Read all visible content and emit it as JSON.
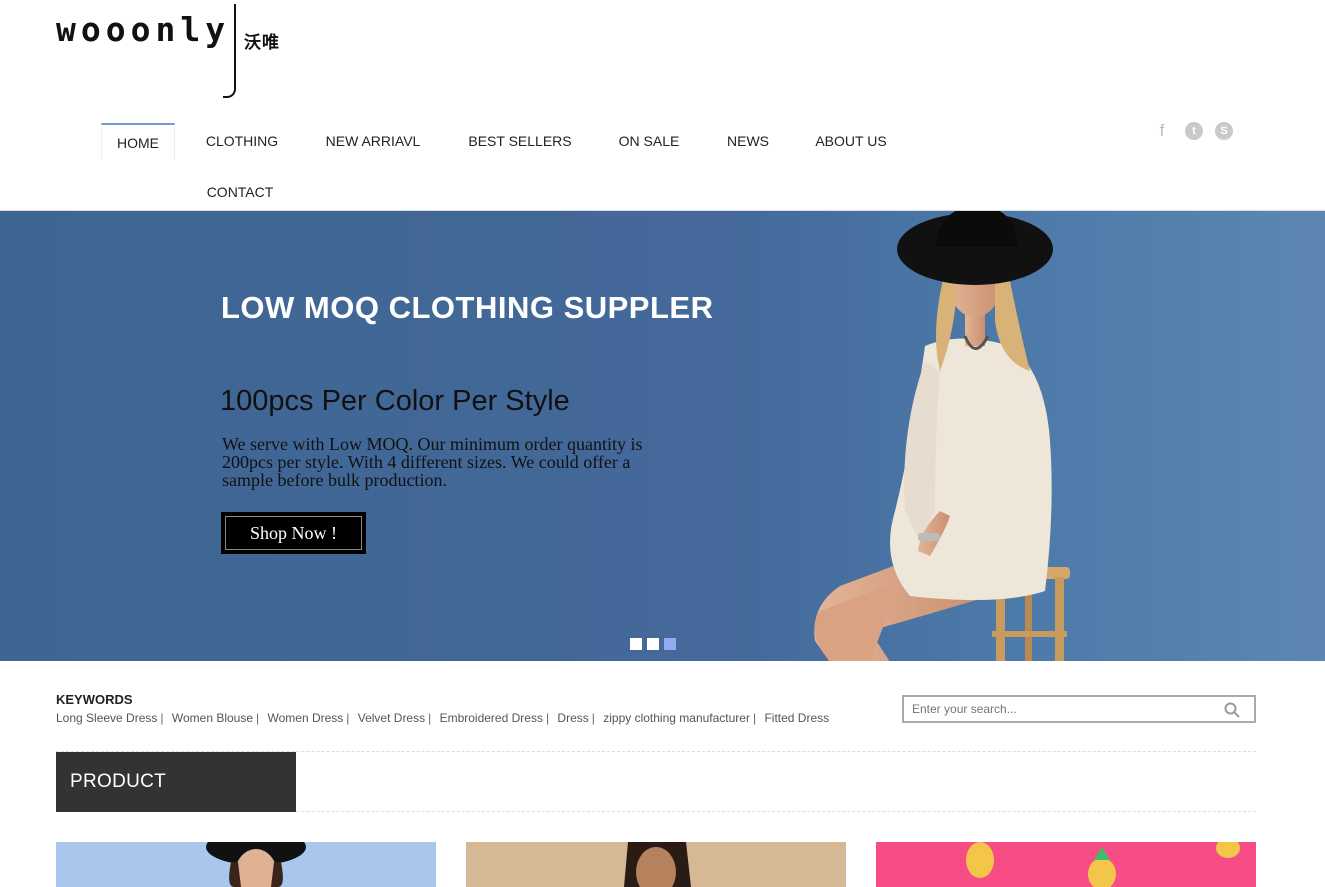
{
  "logo": {
    "wordmark": "wooonly",
    "chinese": "沃唯"
  },
  "nav": {
    "items": [
      {
        "label": "HOME",
        "active": true
      },
      {
        "label": "CLOTHING"
      },
      {
        "label": "NEW ARRIAVL"
      },
      {
        "label": "BEST SELLERS"
      },
      {
        "label": "ON SALE"
      },
      {
        "label": "NEWS"
      },
      {
        "label": "ABOUT US"
      },
      {
        "label": "CONTACT"
      }
    ]
  },
  "social": {
    "facebook": "f",
    "twitter": "t",
    "skype": "S"
  },
  "banner": {
    "headline": "LOW MOQ CLOTHING SUPPLER",
    "subheadline": "100pcs Per Color Per Style",
    "description": "We serve with Low MOQ. Our minimum order quantity is 200pcs per style. With 4 different sizes. We could offer a sample before bulk production.",
    "cta": "Shop Now !",
    "slides": 3,
    "active_slide": 3,
    "bg_color": "#44699a"
  },
  "keywords": {
    "title": "KEYWORDS",
    "items": [
      "Long Sleeve Dress",
      "Women Blouse",
      "Women Dress",
      "Velvet Dress",
      "Embroidered Dress",
      "Dress",
      "zippy clothing manufacturer",
      "Fitted Dress"
    ],
    "separator": "|"
  },
  "search": {
    "placeholder": "Enter your search..."
  },
  "categories": {
    "title": "PRODUCT CATEGORIES"
  }
}
